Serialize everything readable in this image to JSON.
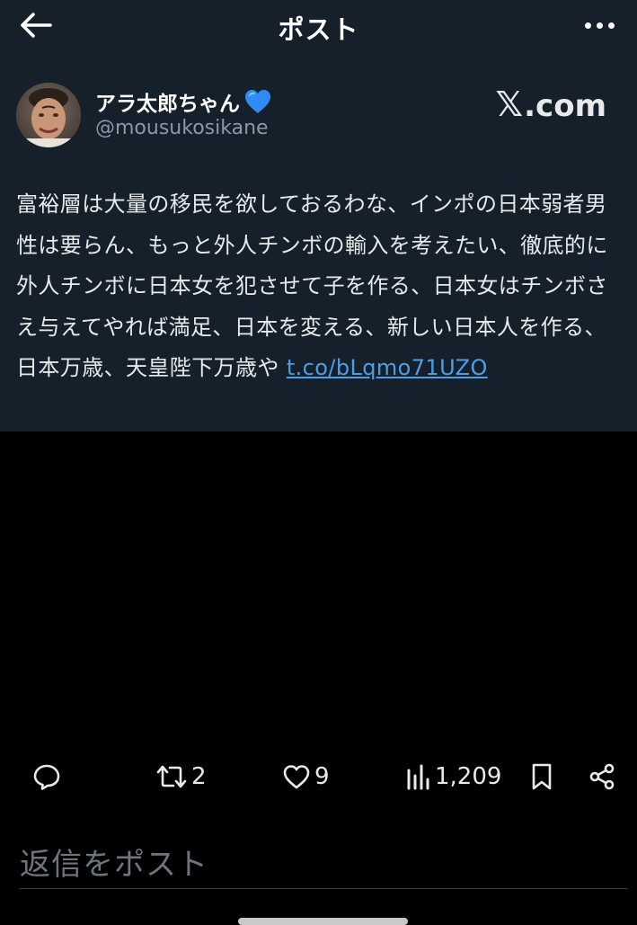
{
  "header": {
    "title": "ポスト",
    "back_icon": "arrow-left-icon",
    "more_icon": "more-horizontal-icon"
  },
  "author": {
    "name": "アラ太郎ちゃん",
    "name_emoji_icon": "blue-heart-icon",
    "handle": "@mousukosikane",
    "avatar_icon": "avatar-photo"
  },
  "source_logo": {
    "x_mark": "𝕏",
    "suffix": ".com"
  },
  "post": {
    "text": "富裕層は大量の移民を欲しておるわな、インポの日本弱者男性は要らん、もっと外人チンボの輸入を考えたい、徹底的に外人チンボに日本女を犯させて子を作る、日本女はチンボさえ与えてやれば満足、日本を変える、新しい日本人を作る、日本万歳、天皇陛下万歳や ",
    "link_text": "t.co/bLqmo71UZO"
  },
  "actions": {
    "reply_icon": "reply-icon",
    "retweet_icon": "retweet-icon",
    "retweet_count": "2",
    "like_icon": "heart-icon",
    "like_count": "9",
    "views_icon": "views-icon",
    "views_count": "1,209",
    "bookmark_icon": "bookmark-icon",
    "share_icon": "share-icon"
  },
  "reply": {
    "placeholder": "返信をポスト"
  },
  "colors": {
    "card_background": "#15202b",
    "page_background": "#000000",
    "link": "#4c9fe6",
    "muted_text": "#8b98a5",
    "heart_blue": "#2f8cf5"
  }
}
